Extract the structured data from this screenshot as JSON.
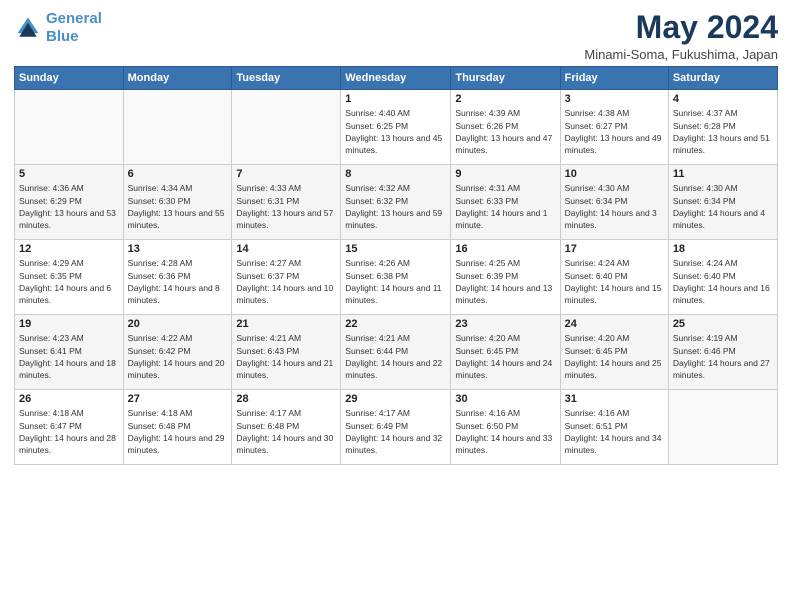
{
  "header": {
    "logo_line1": "General",
    "logo_line2": "Blue",
    "title": "May 2024",
    "subtitle": "Minami-Soma, Fukushima, Japan"
  },
  "weekdays": [
    "Sunday",
    "Monday",
    "Tuesday",
    "Wednesday",
    "Thursday",
    "Friday",
    "Saturday"
  ],
  "weeks": [
    [
      {
        "day": "",
        "sunrise": "",
        "sunset": "",
        "daylight": ""
      },
      {
        "day": "",
        "sunrise": "",
        "sunset": "",
        "daylight": ""
      },
      {
        "day": "",
        "sunrise": "",
        "sunset": "",
        "daylight": ""
      },
      {
        "day": "1",
        "sunrise": "Sunrise: 4:40 AM",
        "sunset": "Sunset: 6:25 PM",
        "daylight": "Daylight: 13 hours and 45 minutes."
      },
      {
        "day": "2",
        "sunrise": "Sunrise: 4:39 AM",
        "sunset": "Sunset: 6:26 PM",
        "daylight": "Daylight: 13 hours and 47 minutes."
      },
      {
        "day": "3",
        "sunrise": "Sunrise: 4:38 AM",
        "sunset": "Sunset: 6:27 PM",
        "daylight": "Daylight: 13 hours and 49 minutes."
      },
      {
        "day": "4",
        "sunrise": "Sunrise: 4:37 AM",
        "sunset": "Sunset: 6:28 PM",
        "daylight": "Daylight: 13 hours and 51 minutes."
      }
    ],
    [
      {
        "day": "5",
        "sunrise": "Sunrise: 4:36 AM",
        "sunset": "Sunset: 6:29 PM",
        "daylight": "Daylight: 13 hours and 53 minutes."
      },
      {
        "day": "6",
        "sunrise": "Sunrise: 4:34 AM",
        "sunset": "Sunset: 6:30 PM",
        "daylight": "Daylight: 13 hours and 55 minutes."
      },
      {
        "day": "7",
        "sunrise": "Sunrise: 4:33 AM",
        "sunset": "Sunset: 6:31 PM",
        "daylight": "Daylight: 13 hours and 57 minutes."
      },
      {
        "day": "8",
        "sunrise": "Sunrise: 4:32 AM",
        "sunset": "Sunset: 6:32 PM",
        "daylight": "Daylight: 13 hours and 59 minutes."
      },
      {
        "day": "9",
        "sunrise": "Sunrise: 4:31 AM",
        "sunset": "Sunset: 6:33 PM",
        "daylight": "Daylight: 14 hours and 1 minute."
      },
      {
        "day": "10",
        "sunrise": "Sunrise: 4:30 AM",
        "sunset": "Sunset: 6:34 PM",
        "daylight": "Daylight: 14 hours and 3 minutes."
      },
      {
        "day": "11",
        "sunrise": "Sunrise: 4:30 AM",
        "sunset": "Sunset: 6:34 PM",
        "daylight": "Daylight: 14 hours and 4 minutes."
      }
    ],
    [
      {
        "day": "12",
        "sunrise": "Sunrise: 4:29 AM",
        "sunset": "Sunset: 6:35 PM",
        "daylight": "Daylight: 14 hours and 6 minutes."
      },
      {
        "day": "13",
        "sunrise": "Sunrise: 4:28 AM",
        "sunset": "Sunset: 6:36 PM",
        "daylight": "Daylight: 14 hours and 8 minutes."
      },
      {
        "day": "14",
        "sunrise": "Sunrise: 4:27 AM",
        "sunset": "Sunset: 6:37 PM",
        "daylight": "Daylight: 14 hours and 10 minutes."
      },
      {
        "day": "15",
        "sunrise": "Sunrise: 4:26 AM",
        "sunset": "Sunset: 6:38 PM",
        "daylight": "Daylight: 14 hours and 11 minutes."
      },
      {
        "day": "16",
        "sunrise": "Sunrise: 4:25 AM",
        "sunset": "Sunset: 6:39 PM",
        "daylight": "Daylight: 14 hours and 13 minutes."
      },
      {
        "day": "17",
        "sunrise": "Sunrise: 4:24 AM",
        "sunset": "Sunset: 6:40 PM",
        "daylight": "Daylight: 14 hours and 15 minutes."
      },
      {
        "day": "18",
        "sunrise": "Sunrise: 4:24 AM",
        "sunset": "Sunset: 6:40 PM",
        "daylight": "Daylight: 14 hours and 16 minutes."
      }
    ],
    [
      {
        "day": "19",
        "sunrise": "Sunrise: 4:23 AM",
        "sunset": "Sunset: 6:41 PM",
        "daylight": "Daylight: 14 hours and 18 minutes."
      },
      {
        "day": "20",
        "sunrise": "Sunrise: 4:22 AM",
        "sunset": "Sunset: 6:42 PM",
        "daylight": "Daylight: 14 hours and 20 minutes."
      },
      {
        "day": "21",
        "sunrise": "Sunrise: 4:21 AM",
        "sunset": "Sunset: 6:43 PM",
        "daylight": "Daylight: 14 hours and 21 minutes."
      },
      {
        "day": "22",
        "sunrise": "Sunrise: 4:21 AM",
        "sunset": "Sunset: 6:44 PM",
        "daylight": "Daylight: 14 hours and 22 minutes."
      },
      {
        "day": "23",
        "sunrise": "Sunrise: 4:20 AM",
        "sunset": "Sunset: 6:45 PM",
        "daylight": "Daylight: 14 hours and 24 minutes."
      },
      {
        "day": "24",
        "sunrise": "Sunrise: 4:20 AM",
        "sunset": "Sunset: 6:45 PM",
        "daylight": "Daylight: 14 hours and 25 minutes."
      },
      {
        "day": "25",
        "sunrise": "Sunrise: 4:19 AM",
        "sunset": "Sunset: 6:46 PM",
        "daylight": "Daylight: 14 hours and 27 minutes."
      }
    ],
    [
      {
        "day": "26",
        "sunrise": "Sunrise: 4:18 AM",
        "sunset": "Sunset: 6:47 PM",
        "daylight": "Daylight: 14 hours and 28 minutes."
      },
      {
        "day": "27",
        "sunrise": "Sunrise: 4:18 AM",
        "sunset": "Sunset: 6:48 PM",
        "daylight": "Daylight: 14 hours and 29 minutes."
      },
      {
        "day": "28",
        "sunrise": "Sunrise: 4:17 AM",
        "sunset": "Sunset: 6:48 PM",
        "daylight": "Daylight: 14 hours and 30 minutes."
      },
      {
        "day": "29",
        "sunrise": "Sunrise: 4:17 AM",
        "sunset": "Sunset: 6:49 PM",
        "daylight": "Daylight: 14 hours and 32 minutes."
      },
      {
        "day": "30",
        "sunrise": "Sunrise: 4:16 AM",
        "sunset": "Sunset: 6:50 PM",
        "daylight": "Daylight: 14 hours and 33 minutes."
      },
      {
        "day": "31",
        "sunrise": "Sunrise: 4:16 AM",
        "sunset": "Sunset: 6:51 PM",
        "daylight": "Daylight: 14 hours and 34 minutes."
      },
      {
        "day": "",
        "sunrise": "",
        "sunset": "",
        "daylight": ""
      }
    ]
  ]
}
